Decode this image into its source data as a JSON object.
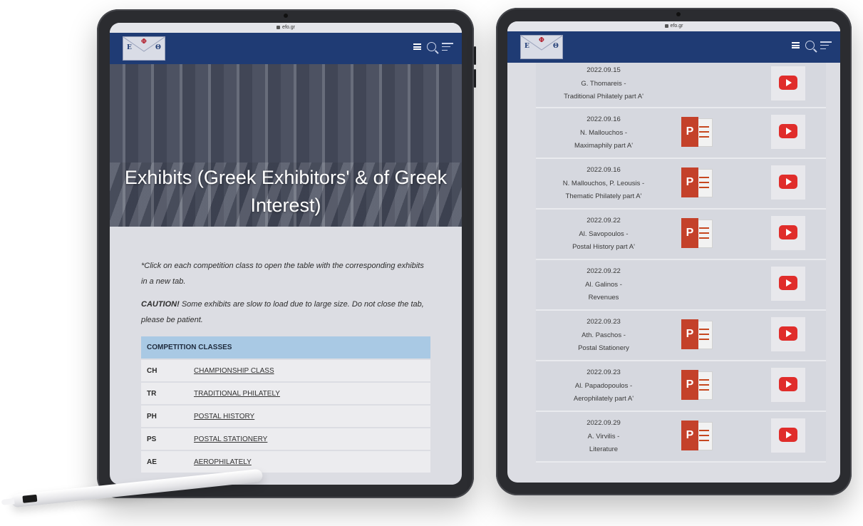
{
  "left_tablet": {
    "url": "efo.gr",
    "logo_letters": [
      "E",
      "Φ",
      "Θ"
    ],
    "hero_title": "Exhibits (Greek Exhibitors' & of Greek Interest)",
    "note_1": "*Click on each competition class to open the table with the corresponding exhibits in a new tab.",
    "caution_label": "CAUTION!",
    "caution_text": " Some exhibits are slow to load due to large size. Do not close the tab, please be patient.",
    "table_header": "COMPETITION CLASSES",
    "classes": [
      {
        "code": "CH",
        "name": "CHAMPIONSHIP CLASS"
      },
      {
        "code": "TR",
        "name": "TRADITIONAL PHILATELY"
      },
      {
        "code": "PH",
        "name": "POSTAL HISTORY"
      },
      {
        "code": "PS",
        "name": "POSTAL STATIONERY"
      },
      {
        "code": "AE",
        "name": "AEROPHILATELY"
      }
    ]
  },
  "right_tablet": {
    "url": "efo.gr",
    "logo_letters": [
      "E",
      "Φ",
      "Θ"
    ],
    "ppt_letter": "P",
    "rows": [
      {
        "date": "2022.09.15",
        "speaker": "G. Thomareis -",
        "topic": "Traditional Philately part A'",
        "has_ppt": false
      },
      {
        "date": "2022.09.16",
        "speaker": "N. Mallouchos -",
        "topic": "Maximaphily part A'",
        "has_ppt": true
      },
      {
        "date": "2022.09.16",
        "speaker": "N. Mallouchos, P. Leousis -",
        "topic": "Thematic Philately part A'",
        "has_ppt": true
      },
      {
        "date": "2022.09.22",
        "speaker": "Al. Savopoulos -",
        "topic": "Postal History part A'",
        "has_ppt": true
      },
      {
        "date": "2022.09.22",
        "speaker": "Al. Galinos -",
        "topic": "Revenues",
        "has_ppt": false
      },
      {
        "date": "2022.09.23",
        "speaker": "Ath. Paschos -",
        "topic": "Postal Stationery",
        "has_ppt": true
      },
      {
        "date": "2022.09.23",
        "speaker": "Al. Papadopoulos -",
        "topic": "Aerophilately part A'",
        "has_ppt": true
      },
      {
        "date": "2022.09.29",
        "speaker": "A. Virvilis -",
        "topic": "Literature",
        "has_ppt": true
      }
    ]
  },
  "icons": {
    "menu": "hamburger-icon",
    "search": "search-icon",
    "nav": "menu-lines-icon",
    "slides": "powerpoint-icon",
    "video": "youtube-play-icon"
  },
  "colors": {
    "header": "#1f3b74",
    "table_header": "#a9c9e4",
    "youtube_red": "#e02d2b",
    "powerpoint_red": "#c4412a"
  }
}
